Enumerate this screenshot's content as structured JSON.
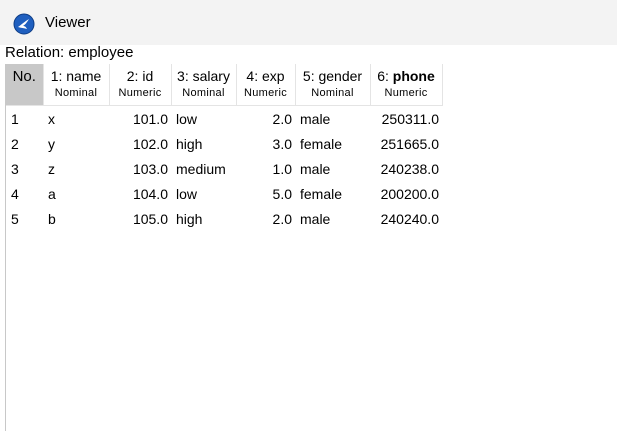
{
  "window": {
    "title": "Viewer",
    "icon": "weka-bird-icon"
  },
  "relation_label": "Relation: employee",
  "table": {
    "no_header": "No.",
    "columns": [
      {
        "name": "1: name",
        "type": "Nominal",
        "bold": false
      },
      {
        "name": "2: id",
        "type": "Numeric",
        "bold": false
      },
      {
        "name": "3: salary",
        "type": "Nominal",
        "bold": false
      },
      {
        "name": "4: exp",
        "type": "Numeric",
        "bold": false
      },
      {
        "name": "5: gender",
        "type": "Nominal",
        "bold": false
      },
      {
        "name_prefix": "6: ",
        "name_bold": "phone",
        "type": "Numeric",
        "bold": true
      }
    ],
    "rows": [
      [
        "1",
        "x",
        "101.0",
        "low",
        "2.0",
        "male",
        "250311.0"
      ],
      [
        "2",
        "y",
        "102.0",
        "high",
        "3.0",
        "female",
        "251665.0"
      ],
      [
        "3",
        "z",
        "103.0",
        "medium",
        "1.0",
        "male",
        "240238.0"
      ],
      [
        "4",
        "a",
        "104.0",
        "low",
        "5.0",
        "female",
        "200200.0"
      ],
      [
        "5",
        "b",
        "105.0",
        "high",
        "2.0",
        "male",
        "240240.0"
      ]
    ]
  },
  "colors": {
    "no_header_bg": "#c8c8c8",
    "titlebar_bg": "#f3f3f3",
    "icon_blue": "#1f5fbf"
  }
}
